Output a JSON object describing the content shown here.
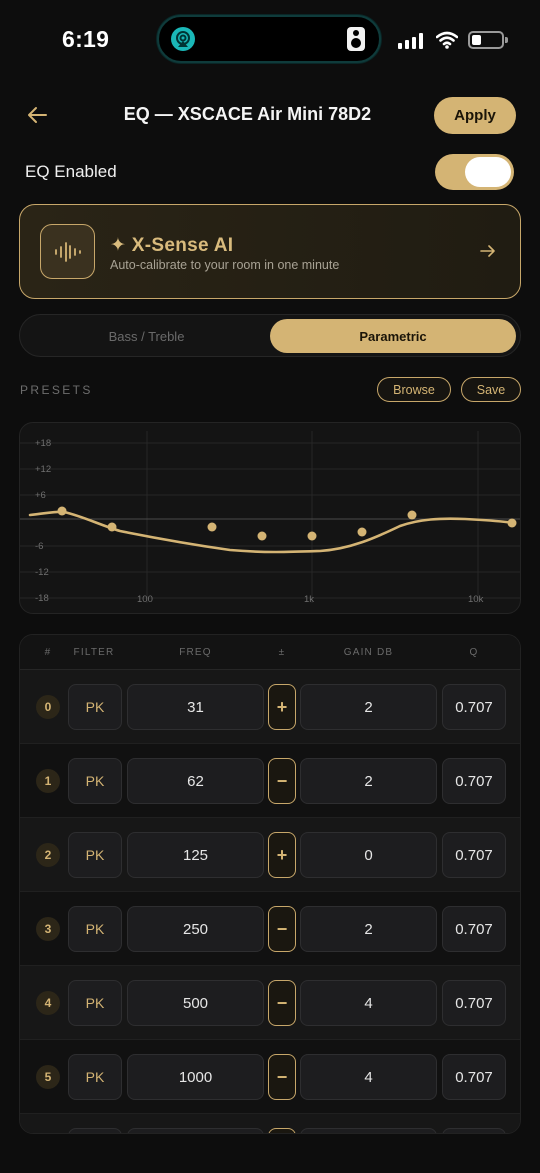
{
  "status_bar": {
    "time": "6:19"
  },
  "header": {
    "title": "EQ — XSCACE Air Mini 78D2",
    "apply_label": "Apply"
  },
  "eq_enabled": {
    "label": "EQ Enabled",
    "on": true
  },
  "xsense": {
    "title": "✦ X-Sense AI",
    "subtitle": "Auto-calibrate to your room in one minute"
  },
  "mode_tabs": {
    "bass_treble": "Bass / Treble",
    "parametric": "Parametric",
    "selected": "parametric"
  },
  "presets": {
    "label": "PRESETS",
    "browse_label": "Browse",
    "save_label": "Save"
  },
  "graph": {
    "db_ticks": [
      "+18",
      "+12",
      "+6",
      "-6",
      "-12",
      "-18"
    ],
    "freq_ticks": [
      "100",
      "1k",
      "10k"
    ]
  },
  "table": {
    "headers": {
      "idx": "#",
      "filter": "FILTER",
      "freq": "FREQ",
      "sign": "±",
      "gain": "GAIN DB",
      "q": "Q"
    },
    "rows": [
      {
        "idx": "0",
        "filter": "PK",
        "freq": "31",
        "sign": "+",
        "gain": "2",
        "q": "0.707"
      },
      {
        "idx": "1",
        "filter": "PK",
        "freq": "62",
        "sign": "−",
        "gain": "2",
        "q": "0.707"
      },
      {
        "idx": "2",
        "filter": "PK",
        "freq": "125",
        "sign": "+",
        "gain": "0",
        "q": "0.707"
      },
      {
        "idx": "3",
        "filter": "PK",
        "freq": "250",
        "sign": "−",
        "gain": "2",
        "q": "0.707"
      },
      {
        "idx": "4",
        "filter": "PK",
        "freq": "500",
        "sign": "−",
        "gain": "4",
        "q": "0.707"
      },
      {
        "idx": "5",
        "filter": "PK",
        "freq": "1000",
        "sign": "−",
        "gain": "4",
        "q": "0.707"
      }
    ]
  },
  "colors": {
    "accent": "#d4b474",
    "background": "#0d0d0d"
  }
}
